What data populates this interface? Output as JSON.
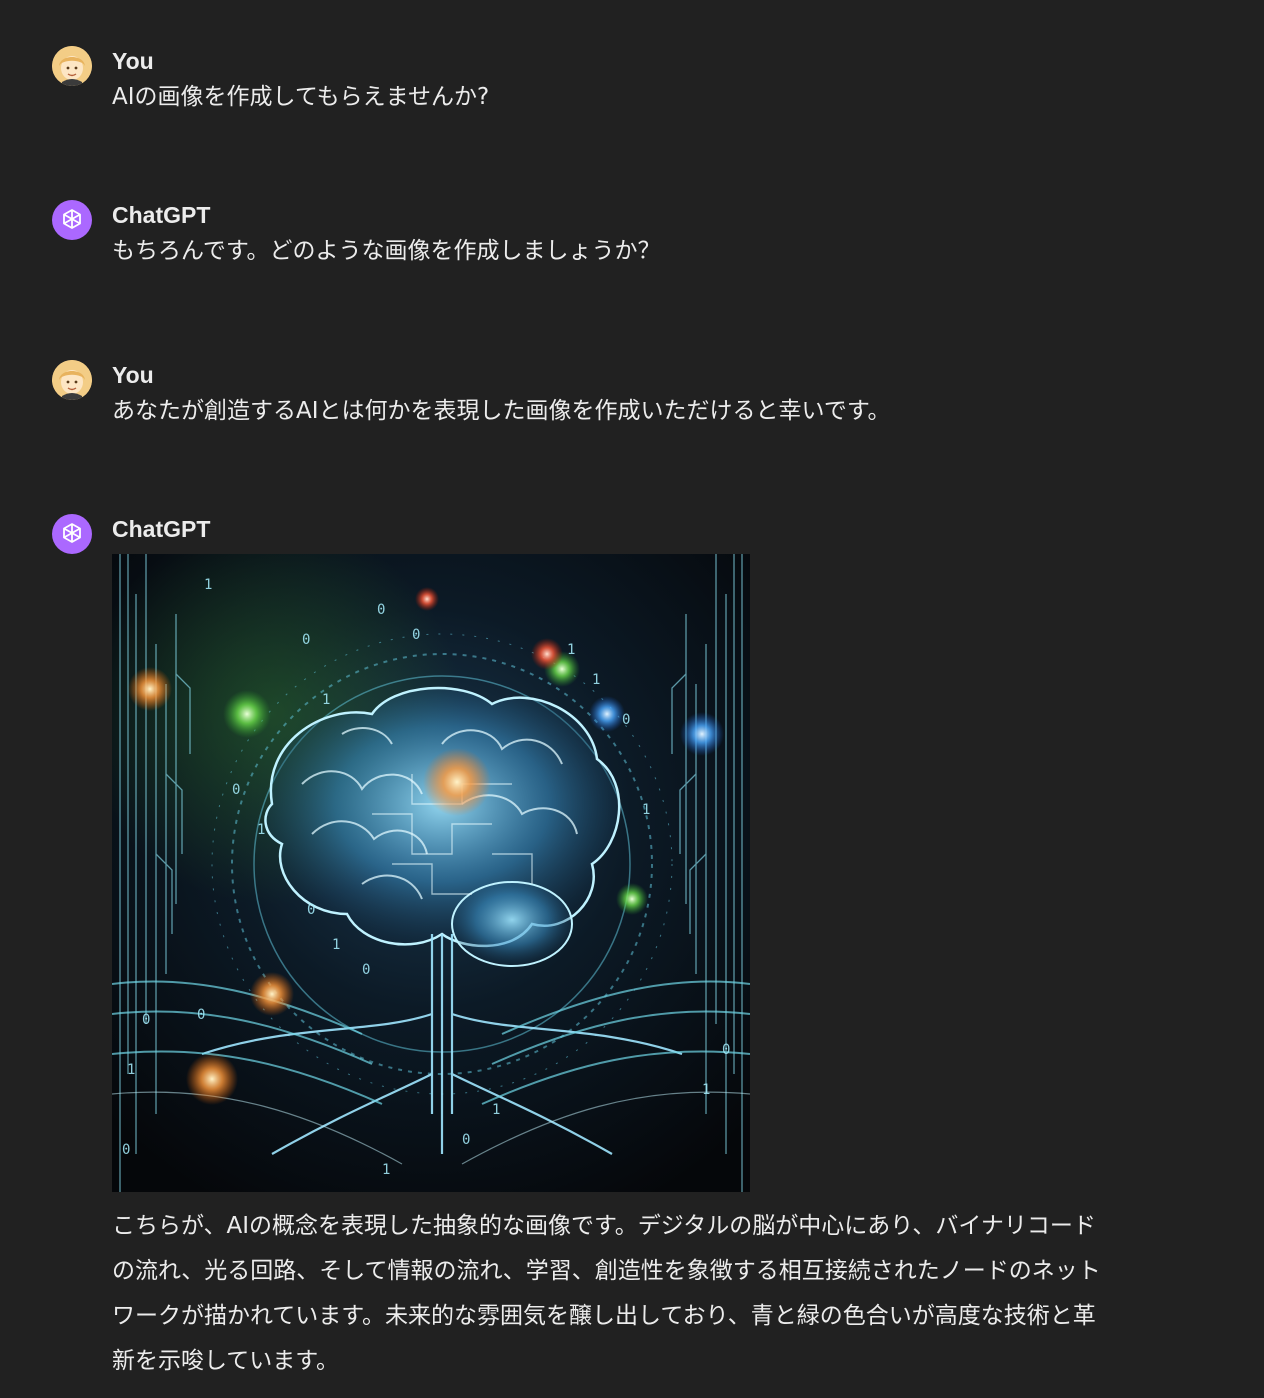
{
  "messages": [
    {
      "author": "You",
      "text": "AIの画像を作成してもらえませんか?"
    },
    {
      "author": "ChatGPT",
      "text": "もちろんです。どのような画像を作成しましょうか？"
    },
    {
      "author": "You",
      "text": "あなたが創造するAIとは何かを表現した画像を作成いただけると幸いです。"
    },
    {
      "author": "ChatGPT",
      "text_lines": [
        "こちらが、AIの概念を表現した抽象的な画像です。デジタルの脳が中心にあり、バイナリコード",
        "の流れ、光る回路、そして情報の流れ、学習、創造性を象徴する相互接続されたノードのネット",
        "ワークが描かれています。未来的な雰囲気を醸し出しており、青と緑の色合いが高度な技術と革",
        "新を示唆しています。"
      ]
    }
  ],
  "icons": {
    "user_avatar": "user-avatar-icon",
    "assistant_avatar": "openai-logo-icon"
  },
  "colors": {
    "background": "#212121",
    "text": "#ececec",
    "assistant_avatar_bg": "#ab68ff",
    "user_avatar_bg": "#f3cd86"
  }
}
